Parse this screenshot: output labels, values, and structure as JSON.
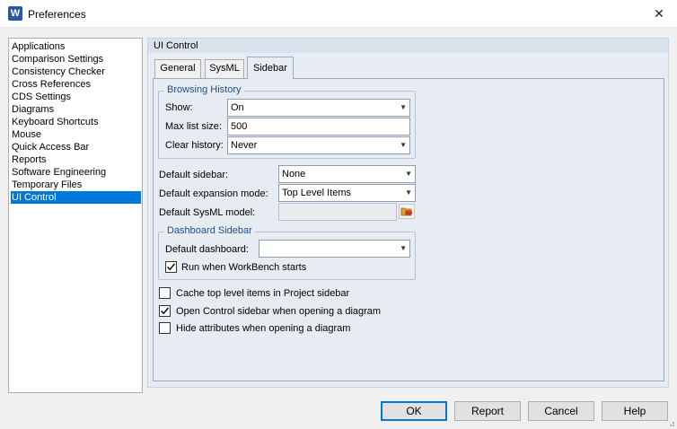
{
  "window": {
    "app_icon_letter": "W",
    "title": "Preferences",
    "close_glyph": "✕"
  },
  "nav": {
    "items": [
      {
        "label": "Applications"
      },
      {
        "label": "Comparison Settings"
      },
      {
        "label": "Consistency Checker"
      },
      {
        "label": "Cross References"
      },
      {
        "label": "CDS Settings"
      },
      {
        "label": "Diagrams"
      },
      {
        "label": "Keyboard Shortcuts"
      },
      {
        "label": "Mouse"
      },
      {
        "label": "Quick Access Bar"
      },
      {
        "label": "Reports"
      },
      {
        "label": "Software Engineering"
      },
      {
        "label": "Temporary Files"
      },
      {
        "label": "UI Control"
      }
    ],
    "selected": "UI Control"
  },
  "panel": {
    "title": "UI Control",
    "tabs": [
      {
        "label": "General"
      },
      {
        "label": "SysML"
      },
      {
        "label": "Sidebar"
      }
    ],
    "active_tab": "Sidebar"
  },
  "browsing_history": {
    "title": "Browsing History",
    "show_label": "Show:",
    "show_value": "On",
    "max_list_label": "Max list size:",
    "max_list_value": "500",
    "clear_label": "Clear history:",
    "clear_value": "Never"
  },
  "defaults": {
    "sidebar_label": "Default sidebar:",
    "sidebar_value": "None",
    "expansion_label": "Default expansion mode:",
    "expansion_value": "Top Level Items",
    "sysml_label": "Default SysML model:",
    "sysml_value": ""
  },
  "dashboard": {
    "title": "Dashboard Sidebar",
    "default_label": "Default dashboard:",
    "default_value": "",
    "run_label": "Run when WorkBench starts",
    "run_checked": true
  },
  "options": [
    {
      "label": "Cache top level items in Project sidebar",
      "checked": false
    },
    {
      "label": "Open Control sidebar when opening a diagram",
      "checked": true
    },
    {
      "label": "Hide attributes when opening a diagram",
      "checked": false
    }
  ],
  "buttons": {
    "ok": "OK",
    "report": "Report",
    "cancel": "Cancel",
    "help": "Help"
  },
  "colors": {
    "selection": "#0078d7",
    "group_title": "#1f4e87",
    "panel_bg": "#e7ecf3"
  }
}
